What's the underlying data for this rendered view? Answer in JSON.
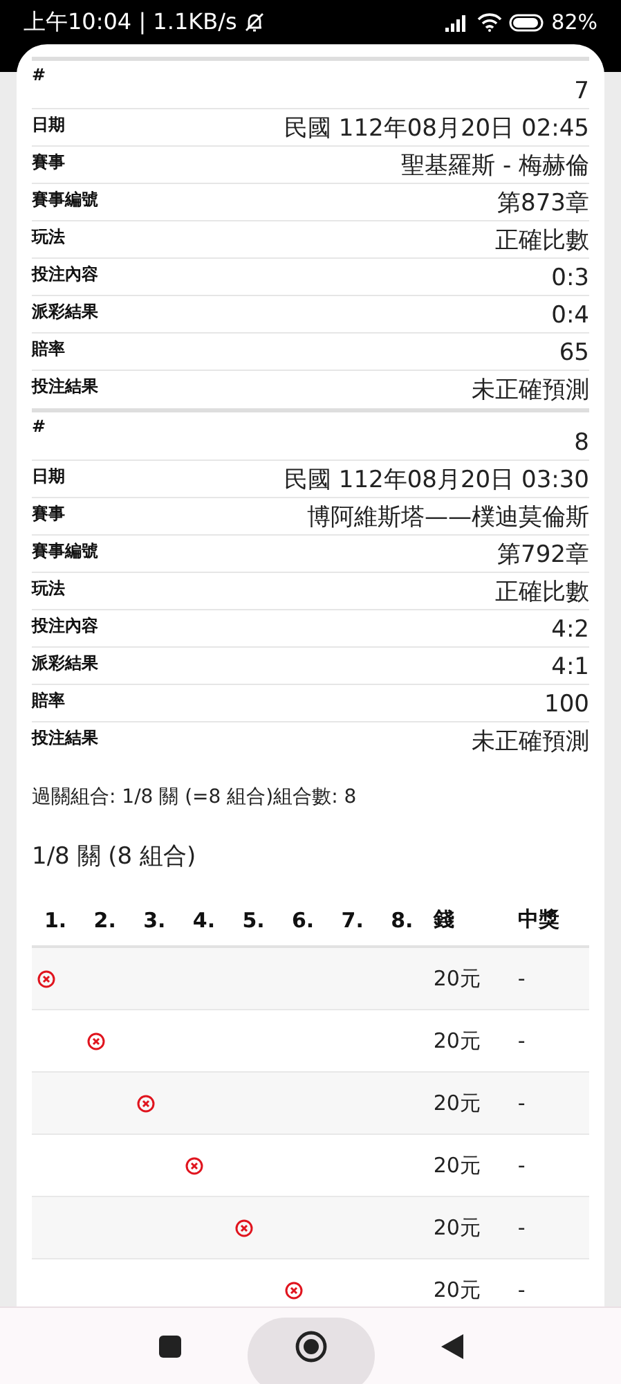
{
  "status_bar": {
    "time": "上午10:04 | 1.1KB/s",
    "battery": "82%"
  },
  "bets": [
    {
      "fields": [
        {
          "label": "#",
          "value": "7"
        },
        {
          "label": "日期",
          "value": "民國 112年08月20日 02:45"
        },
        {
          "label": "賽事",
          "value": "聖基羅斯 - 梅赫倫"
        },
        {
          "label": "賽事編號",
          "value": "第873章"
        },
        {
          "label": "玩法",
          "value": "正確比數"
        },
        {
          "label": "投注內容",
          "value": "0:3"
        },
        {
          "label": "派彩結果",
          "value": "0:4"
        },
        {
          "label": "賠率",
          "value": "65"
        },
        {
          "label": "投注結果",
          "value": "未正確預測"
        }
      ]
    },
    {
      "fields": [
        {
          "label": "#",
          "value": "8"
        },
        {
          "label": "日期",
          "value": "民國 112年08月20日 03:30"
        },
        {
          "label": "賽事",
          "value": "博阿維斯塔——樸迪莫倫斯"
        },
        {
          "label": "賽事編號",
          "value": "第792章"
        },
        {
          "label": "玩法",
          "value": "正確比數"
        },
        {
          "label": "投注內容",
          "value": "4:2"
        },
        {
          "label": "派彩結果",
          "value": "4:1"
        },
        {
          "label": "賠率",
          "value": "100"
        },
        {
          "label": "投注結果",
          "value": "未正確預測"
        }
      ]
    }
  ],
  "summary": "過關組合: 1/8 關 (=8 組合)組合數: 8",
  "combos": {
    "title": "1/8 關 (8 組合)",
    "columns": [
      "1.",
      "2.",
      "3.",
      "4.",
      "5.",
      "6.",
      "7.",
      "8.",
      "錢",
      "中獎"
    ],
    "rows": [
      {
        "legs": [
          {
            "kind": "lost"
          },
          {
            "kind": "none"
          },
          {
            "kind": "none"
          },
          {
            "kind": "none"
          },
          {
            "kind": "none"
          },
          {
            "kind": "none"
          },
          {
            "kind": "none"
          },
          {
            "kind": "none"
          }
        ],
        "amount": "20元",
        "prize": "-"
      },
      {
        "legs": [
          {
            "kind": "none"
          },
          {
            "kind": "lost"
          },
          {
            "kind": "none"
          },
          {
            "kind": "none"
          },
          {
            "kind": "none"
          },
          {
            "kind": "none"
          },
          {
            "kind": "none"
          },
          {
            "kind": "none"
          }
        ],
        "amount": "20元",
        "prize": "-"
      },
      {
        "legs": [
          {
            "kind": "none"
          },
          {
            "kind": "none"
          },
          {
            "kind": "lost"
          },
          {
            "kind": "none"
          },
          {
            "kind": "none"
          },
          {
            "kind": "none"
          },
          {
            "kind": "none"
          },
          {
            "kind": "none"
          }
        ],
        "amount": "20元",
        "prize": "-"
      },
      {
        "legs": [
          {
            "kind": "none"
          },
          {
            "kind": "none"
          },
          {
            "kind": "none"
          },
          {
            "kind": "lost"
          },
          {
            "kind": "none"
          },
          {
            "kind": "none"
          },
          {
            "kind": "none"
          },
          {
            "kind": "none"
          }
        ],
        "amount": "20元",
        "prize": "-"
      },
      {
        "legs": [
          {
            "kind": "none"
          },
          {
            "kind": "none"
          },
          {
            "kind": "none"
          },
          {
            "kind": "none"
          },
          {
            "kind": "lost"
          },
          {
            "kind": "none"
          },
          {
            "kind": "none"
          },
          {
            "kind": "none"
          }
        ],
        "amount": "20元",
        "prize": "-"
      },
      {
        "legs": [
          {
            "kind": "none"
          },
          {
            "kind": "none"
          },
          {
            "kind": "none"
          },
          {
            "kind": "none"
          },
          {
            "kind": "none"
          },
          {
            "kind": "lost"
          },
          {
            "kind": "none"
          },
          {
            "kind": "none"
          }
        ],
        "amount": "20元",
        "prize": "-"
      }
    ]
  }
}
